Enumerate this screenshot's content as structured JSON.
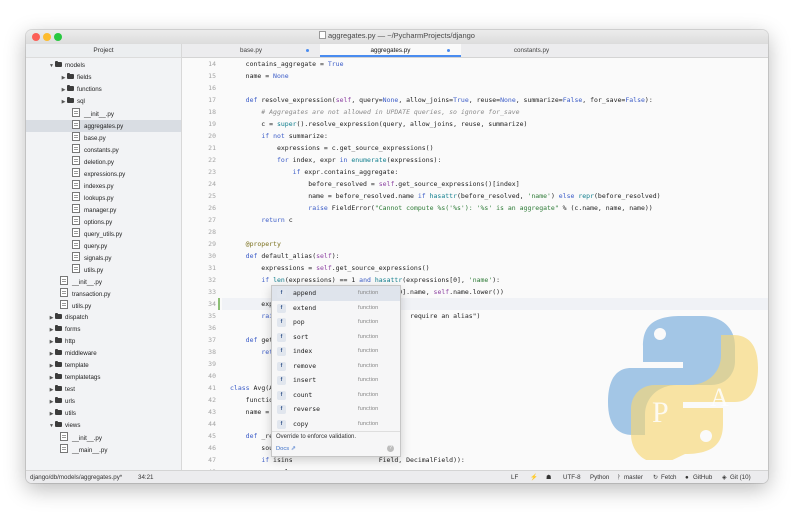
{
  "window": {
    "title": "aggregates.py — ~/PycharmProjects/django"
  },
  "sidebar": {
    "header": "Project",
    "tree": [
      {
        "label": "models",
        "kind": "folder",
        "open": true,
        "depth": 0
      },
      {
        "label": "fields",
        "kind": "folder",
        "open": false,
        "depth": 1
      },
      {
        "label": "functions",
        "kind": "folder",
        "open": false,
        "depth": 1
      },
      {
        "label": "sql",
        "kind": "folder",
        "open": false,
        "depth": 1
      },
      {
        "label": "__init__.py",
        "kind": "file",
        "depth": 2
      },
      {
        "label": "aggregates.py",
        "kind": "file",
        "depth": 2,
        "selected": true
      },
      {
        "label": "base.py",
        "kind": "file",
        "depth": 2
      },
      {
        "label": "constants.py",
        "kind": "file",
        "depth": 2
      },
      {
        "label": "deletion.py",
        "kind": "file",
        "depth": 2
      },
      {
        "label": "expressions.py",
        "kind": "file",
        "depth": 2
      },
      {
        "label": "indexes.py",
        "kind": "file",
        "depth": 2
      },
      {
        "label": "lookups.py",
        "kind": "file",
        "depth": 2
      },
      {
        "label": "manager.py",
        "kind": "file",
        "depth": 2
      },
      {
        "label": "options.py",
        "kind": "file",
        "depth": 2
      },
      {
        "label": "query_utils.py",
        "kind": "file",
        "depth": 2
      },
      {
        "label": "query.py",
        "kind": "file",
        "depth": 2
      },
      {
        "label": "signals.py",
        "kind": "file",
        "depth": 2
      },
      {
        "label": "utils.py",
        "kind": "file",
        "depth": 2
      },
      {
        "label": "__init__.py",
        "kind": "file",
        "depth": 1
      },
      {
        "label": "transaction.py",
        "kind": "file",
        "depth": 1
      },
      {
        "label": "utils.py",
        "kind": "file",
        "depth": 1
      },
      {
        "label": "dispatch",
        "kind": "folder",
        "open": false,
        "depth": 0
      },
      {
        "label": "forms",
        "kind": "folder",
        "open": false,
        "depth": 0
      },
      {
        "label": "http",
        "kind": "folder",
        "open": false,
        "depth": 0
      },
      {
        "label": "middleware",
        "kind": "folder",
        "open": false,
        "depth": 0
      },
      {
        "label": "template",
        "kind": "folder",
        "open": false,
        "depth": 0
      },
      {
        "label": "templatetags",
        "kind": "folder",
        "open": false,
        "depth": 0
      },
      {
        "label": "test",
        "kind": "folder",
        "open": false,
        "depth": 0
      },
      {
        "label": "urls",
        "kind": "folder",
        "open": false,
        "depth": 0
      },
      {
        "label": "utils",
        "kind": "folder",
        "open": false,
        "depth": 0
      },
      {
        "label": "views",
        "kind": "folder",
        "open": true,
        "depth": 0
      },
      {
        "label": "__init__.py",
        "kind": "file",
        "depth": 1
      },
      {
        "label": "__main__.py",
        "kind": "file",
        "depth": 1
      }
    ]
  },
  "tabs": [
    {
      "label": "base.py",
      "modified": true
    },
    {
      "label": "aggregates.py",
      "modified": true,
      "active": true
    },
    {
      "label": "constants.py",
      "modified": false
    }
  ],
  "editor": {
    "current_line": 34,
    "lines": [
      {
        "n": "14",
        "code": "    contains_aggregate = True"
      },
      {
        "n": "15",
        "code": "    name = None"
      },
      {
        "n": "16",
        "code": ""
      },
      {
        "n": "17",
        "code": "    def resolve_expression(self, query=None, allow_joins=True, reuse=None, summarize=False, for_save=False):"
      },
      {
        "n": "18",
        "code": "        # Aggregates are not allowed in UPDATE queries, so ignore for_save"
      },
      {
        "n": "19",
        "code": "        c = super().resolve_expression(query, allow_joins, reuse, summarize)"
      },
      {
        "n": "20",
        "code": "        if not summarize:"
      },
      {
        "n": "21",
        "code": "            expressions = c.get_source_expressions()"
      },
      {
        "n": "22",
        "code": "            for index, expr in enumerate(expressions):"
      },
      {
        "n": "23",
        "code": "                if expr.contains_aggregate:"
      },
      {
        "n": "24",
        "code": "                    before_resolved = self.get_source_expressions()[index]"
      },
      {
        "n": "25",
        "code": "                    name = before_resolved.name if hasattr(before_resolved, 'name') else repr(before_resolved)"
      },
      {
        "n": "26",
        "code": "                    raise FieldError(\"Cannot compute %s('%s'): '%s' is an aggregate\" % (c.name, name, name))"
      },
      {
        "n": "27",
        "code": "        return c"
      },
      {
        "n": "28",
        "code": ""
      },
      {
        "n": "29",
        "code": "    @property"
      },
      {
        "n": "30",
        "code": "    def default_alias(self):"
      },
      {
        "n": "31",
        "code": "        expressions = self.get_source_expressions()"
      },
      {
        "n": "32",
        "code": "        if len(expressions) == 1 and hasattr(expressions[0], 'name'):"
      },
      {
        "n": "33",
        "code": "            return '%s__%s' % (expressions[0].name, self.name.lower())"
      },
      {
        "n": "34",
        "code": "        expressions."
      },
      {
        "n": "35",
        "code": "        raise Ty                              require an alias\")"
      },
      {
        "n": "36",
        "code": ""
      },
      {
        "n": "37",
        "code": "    def get_grou"
      },
      {
        "n": "38",
        "code": "        return"
      },
      {
        "n": "39",
        "code": ""
      },
      {
        "n": "40",
        "code": ""
      },
      {
        "n": "41",
        "code": "class Avg(Aggreg"
      },
      {
        "n": "42",
        "code": "    function ="
      },
      {
        "n": "43",
        "code": "    name = 'Avg"
      },
      {
        "n": "44",
        "code": ""
      },
      {
        "n": "45",
        "code": "    def _resolve"
      },
      {
        "n": "46",
        "code": "        source_t                      s()[0]"
      },
      {
        "n": "47",
        "code": "        if isins                      Field, DecimalField)):"
      },
      {
        "n": "48",
        "code": "            sel"
      },
      {
        "n": "49",
        "code": "        super()."
      },
      {
        "n": "50",
        "code": ""
      },
      {
        "n": "51",
        "code": "    def as_oracle(self, compiler, connection):"
      }
    ]
  },
  "completion": {
    "items": [
      {
        "name": "append",
        "type": "function",
        "icon": "f"
      },
      {
        "name": "extend",
        "type": "function",
        "icon": "f"
      },
      {
        "name": "pop",
        "type": "function",
        "icon": "f"
      },
      {
        "name": "sort",
        "type": "function",
        "icon": "f"
      },
      {
        "name": "index",
        "type": "function",
        "icon": "f"
      },
      {
        "name": "remove",
        "type": "function",
        "icon": "f"
      },
      {
        "name": "insert",
        "type": "function",
        "icon": "f"
      },
      {
        "name": "count",
        "type": "function",
        "icon": "f"
      },
      {
        "name": "reverse",
        "type": "function",
        "icon": "f"
      },
      {
        "name": "copy",
        "type": "function",
        "icon": "f"
      }
    ],
    "doc": "Override to enforce validation.",
    "footer": "Docs ⇗"
  },
  "statusbar": {
    "path": "django/db/models/aggregates.py*",
    "position": "34:21",
    "line_sep": "LF",
    "encoding": "UTF-8",
    "language": "Python",
    "branch": "master",
    "fetch": "Fetch",
    "github": "GitHub",
    "git": "Git (10)"
  },
  "colors": {
    "accent": "#4a8cf0",
    "python_blue": "#5b9bd5",
    "python_yellow": "#f7d774"
  },
  "icons": [
    "folder-icon",
    "python-file-icon",
    "function-icon",
    "branch-icon",
    "fetch-icon",
    "github-icon",
    "git-icon",
    "python-logo"
  ]
}
